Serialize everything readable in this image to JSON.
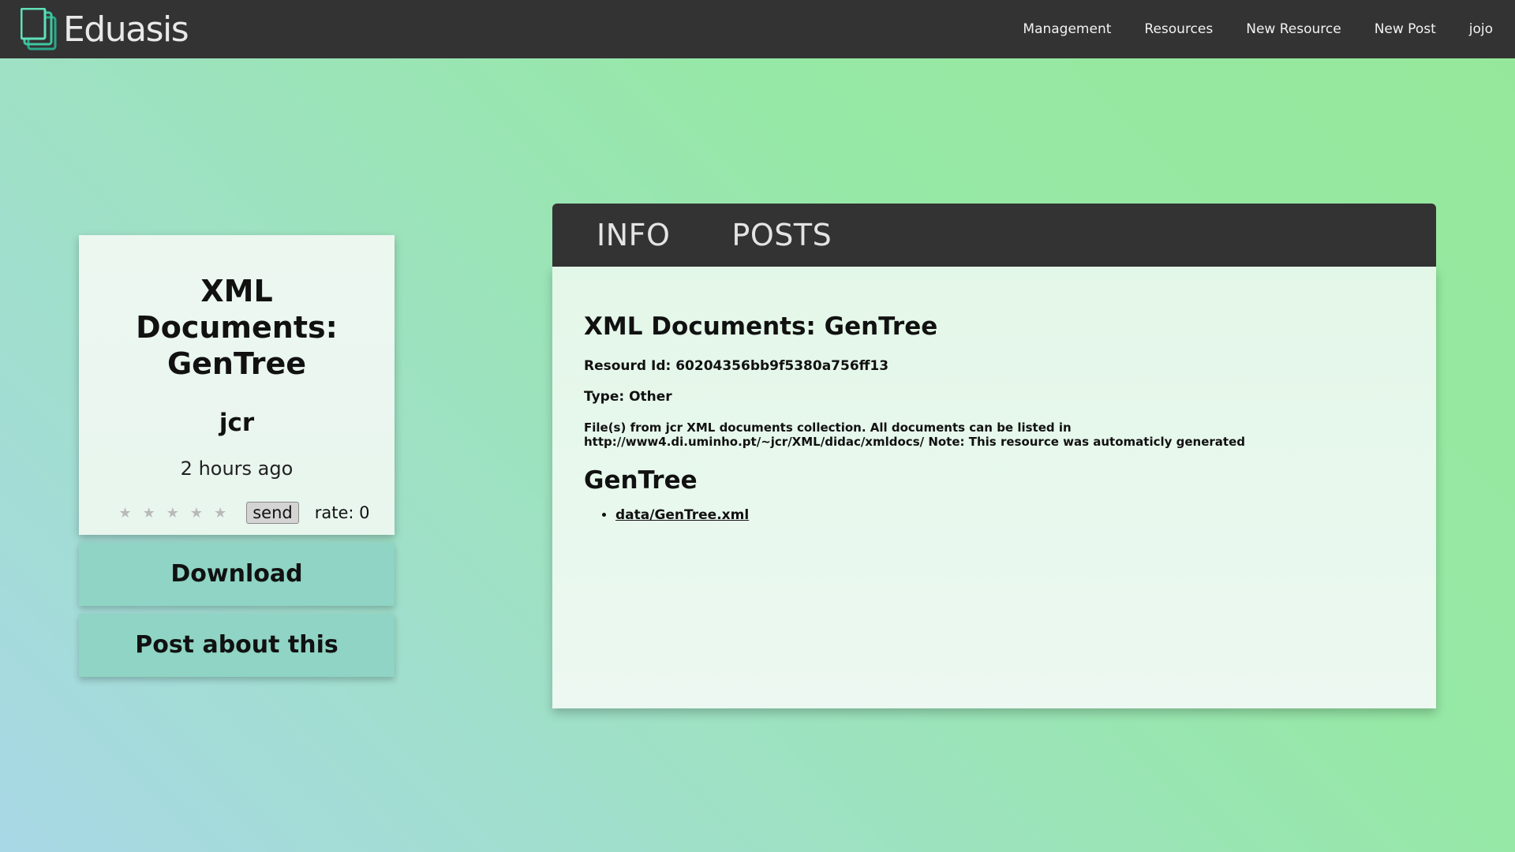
{
  "nav": {
    "brand": "Eduasis",
    "links": [
      "Management",
      "Resources",
      "New Resource",
      "New Post",
      "jojo"
    ]
  },
  "card": {
    "title": "XML Documents: GenTree",
    "author": "jcr",
    "time": "2 hours ago",
    "send_label": "send",
    "rate_label": "rate: 0",
    "stars": "★"
  },
  "actions": {
    "download": "Download",
    "post": "Post about this"
  },
  "tabs": [
    "INFO",
    "POSTS"
  ],
  "info": {
    "title": "XML Documents: GenTree",
    "resource_id": "Resourd Id: 60204356bb9f5380a756ff13",
    "type": "Type: Other",
    "description": "File(s) from jcr XML documents collection. All documents can be listed in http://www4.di.uminho.pt/~jcr/XML/didac/xmldocs/ Note: This resource was automaticly generated",
    "section": "GenTree",
    "files": [
      "data/GenTree.xml"
    ]
  },
  "colors": {
    "navbar": "#333333",
    "accent_button": "#8fd4c4",
    "logo": "#3ec7a0"
  },
  "icons": {
    "logo": "stacked-pages-icon",
    "star": "star-icon"
  }
}
